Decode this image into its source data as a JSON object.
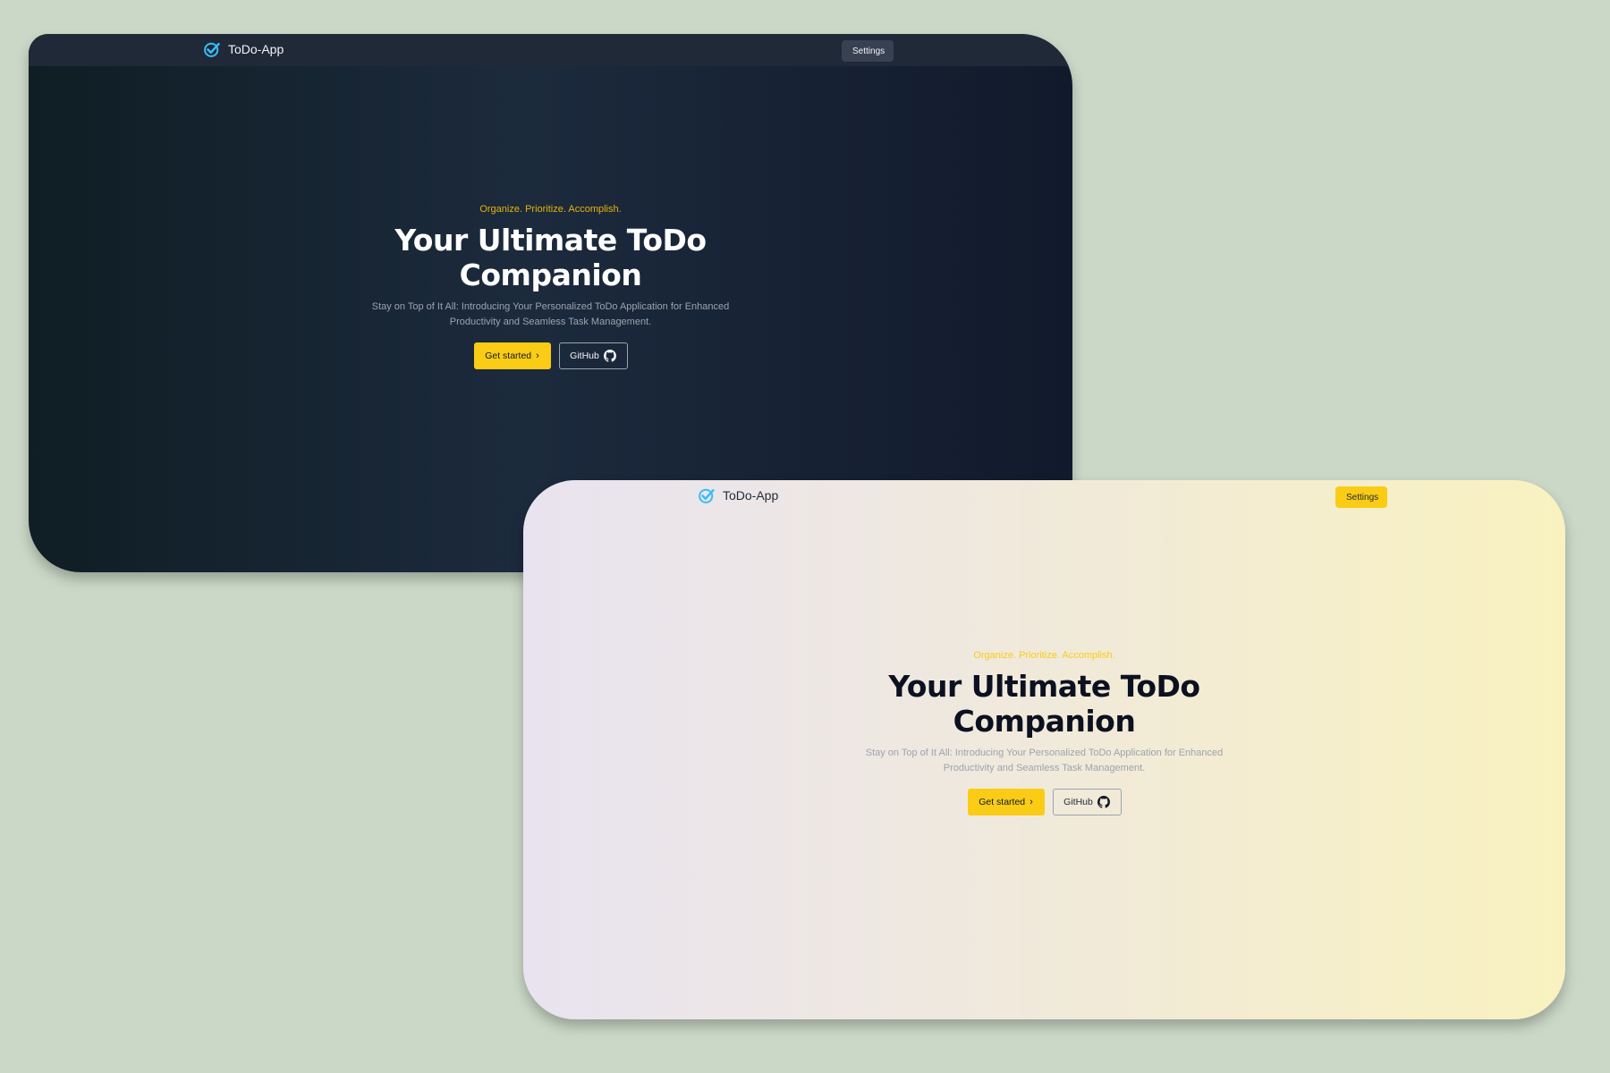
{
  "dark_window": {
    "brand": "ToDo-App",
    "settings_label": "Settings",
    "tagline": "Organize. Prioritize. Accomplish.",
    "headline_line1": "Your Ultimate ToDo",
    "headline_line2": "Companion",
    "subtitle": "Stay on Top of It All: Introducing Your Personalized ToDo Application for Enhanced Productivity and Seamless Task Management.",
    "get_started_label": "Get started",
    "github_label": "GitHub"
  },
  "light_window": {
    "brand": "ToDo-App",
    "settings_label": "Settings",
    "tagline": "Organize. Prioritize. Accomplish.",
    "headline_line1": "Your Ultimate ToDo",
    "headline_line2": "Companion",
    "subtitle": "Stay on Top of It All: Introducing Your Personalized ToDo Application for Enhanced Productivity and Seamless Task Management.",
    "get_started_label": "Get started",
    "github_label": "GitHub"
  },
  "icons": {
    "brand": "check-circle-icon",
    "chevron": "chevron-right-icon",
    "github": "github-icon"
  },
  "colors": {
    "accent": "#facc15",
    "dark_bg": "#1c2a3d",
    "light_bg_end": "#f9f2c0",
    "page_bg": "#cbd8c7"
  }
}
